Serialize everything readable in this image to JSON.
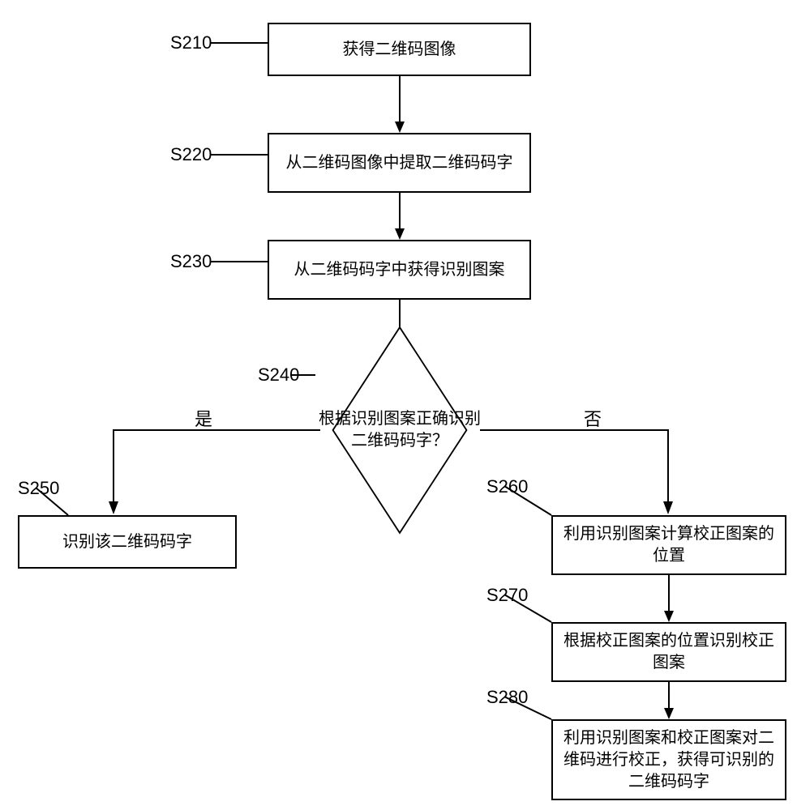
{
  "chart_data": {
    "type": "flowchart",
    "nodes": [
      {
        "id": "S210",
        "shape": "process",
        "text": "获得二维码图像"
      },
      {
        "id": "S220",
        "shape": "process",
        "text": "从二维码图像中提取二维码码字"
      },
      {
        "id": "S230",
        "shape": "process",
        "text": "从二维码码字中获得识别图案"
      },
      {
        "id": "S240",
        "shape": "decision",
        "text": "根据识别图案正确识别二维码码字？"
      },
      {
        "id": "S250",
        "shape": "process",
        "text": "识别该二维码码字"
      },
      {
        "id": "S260",
        "shape": "process",
        "text": "利用识别图案计算校正图案的位置"
      },
      {
        "id": "S270",
        "shape": "process",
        "text": "根据校正图案的位置识别校正图案"
      },
      {
        "id": "S280",
        "shape": "process",
        "text": "利用识别图案和校正图案对二维码进行校正，获得可识别的二维码码字"
      }
    ],
    "edges": [
      {
        "from": "S210",
        "to": "S220",
        "label": ""
      },
      {
        "from": "S220",
        "to": "S230",
        "label": ""
      },
      {
        "from": "S230",
        "to": "S240",
        "label": ""
      },
      {
        "from": "S240",
        "to": "S250",
        "label": "是"
      },
      {
        "from": "S240",
        "to": "S260",
        "label": "否"
      },
      {
        "from": "S260",
        "to": "S270",
        "label": ""
      },
      {
        "from": "S270",
        "to": "S280",
        "label": ""
      }
    ]
  },
  "labels": {
    "s210": "S210",
    "s220": "S220",
    "s230": "S230",
    "s240": "S240",
    "s250": "S250",
    "s260": "S260",
    "s270": "S270",
    "s280": "S280",
    "yes": "是",
    "no": "否"
  },
  "boxes": {
    "b210": "获得二维码图像",
    "b220": "从二维码图像中提取二维码码字",
    "b230": "从二维码码字中获得识别图案",
    "b240_l1": "根据识别图案正确识别",
    "b240_l2": "二维码码字？",
    "b250": "识别该二维码码字",
    "b260": "利用识别图案计算校正图案的位置",
    "b270": "根据校正图案的位置识别校正图案",
    "b280": "利用识别图案和校正图案对二维码进行校正，获得可识别的二维码码字"
  }
}
